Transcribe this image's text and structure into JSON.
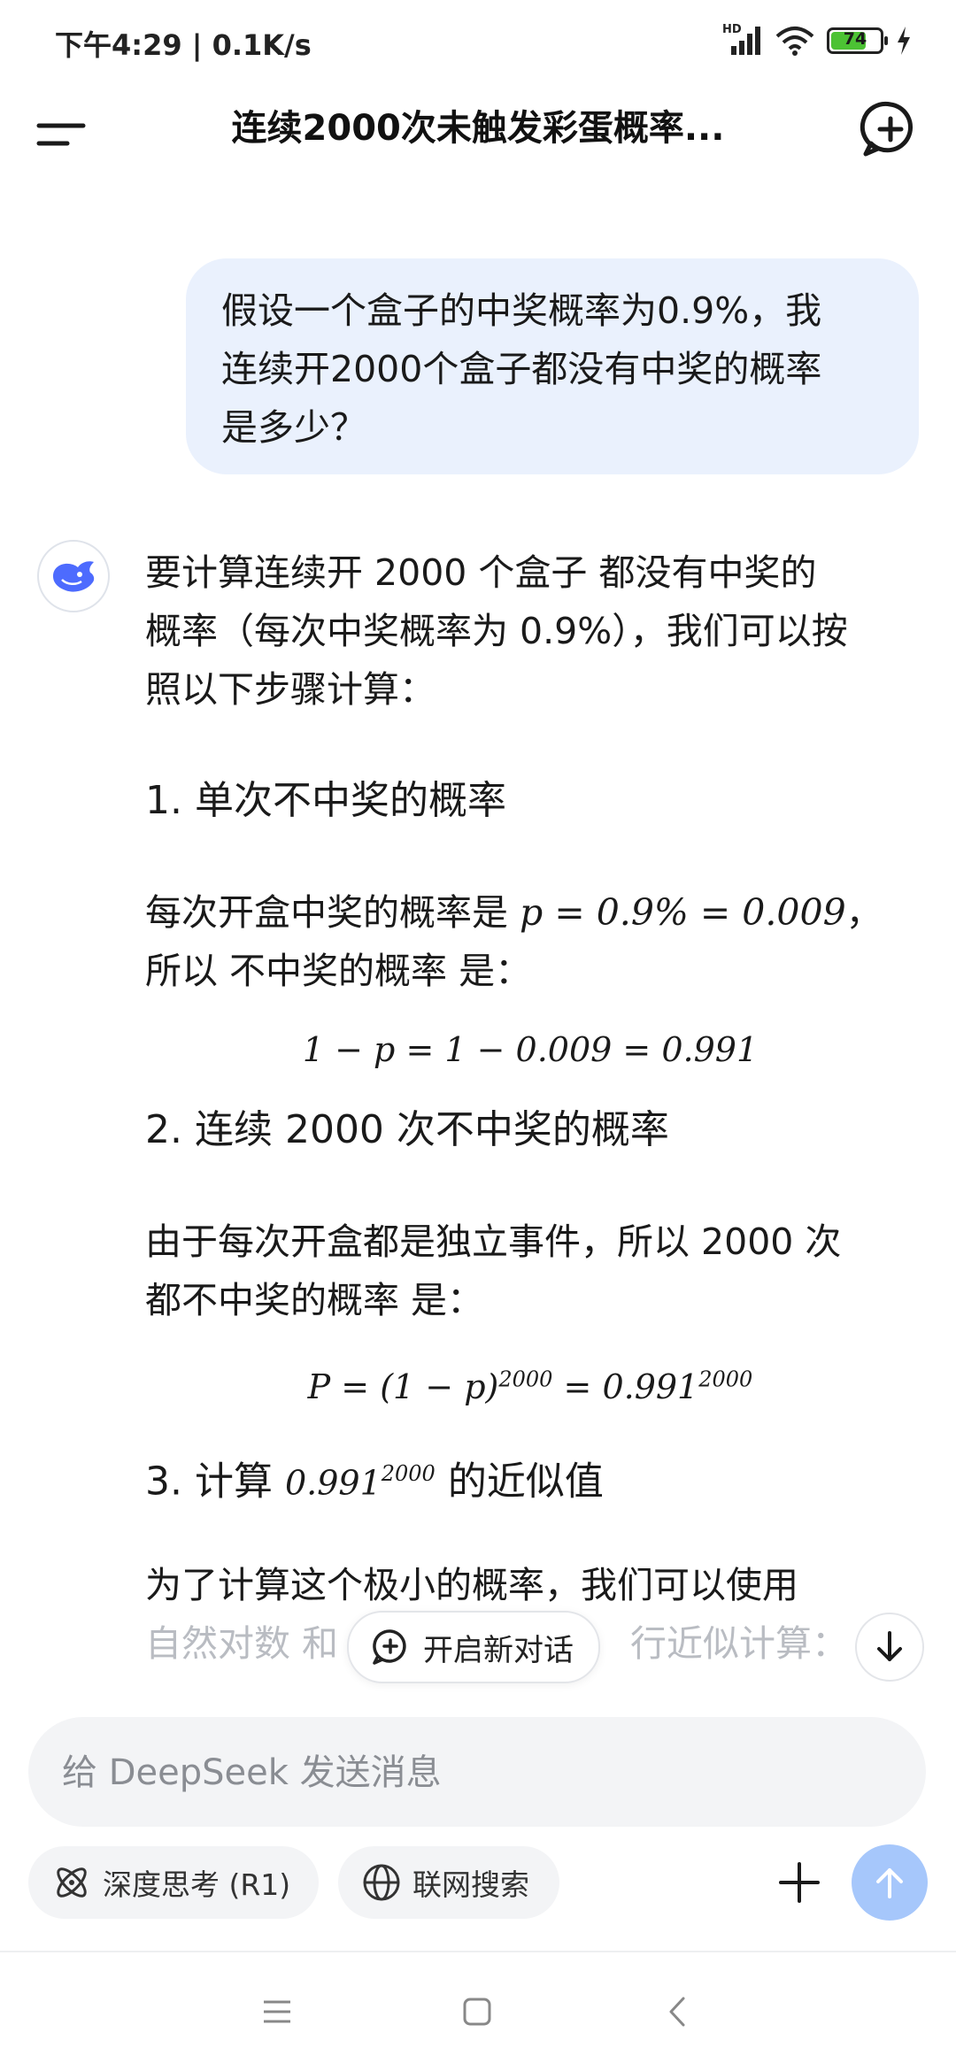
{
  "status_bar": {
    "time_speed": "下午4:29 | 0.1K/s",
    "network_label": "HD",
    "battery_level": 74,
    "battery_text": "74",
    "battery_color": "#4cc234"
  },
  "header": {
    "title": "连续2000次未触发彩蛋概率..."
  },
  "user_message": {
    "lines": [
      "假设一个盒子的中奖概率为0.9%，我",
      "连续开2000个盒子都没有中奖的概率",
      "是多少？"
    ]
  },
  "answer": {
    "intro_lines": [
      "要计算连续开 2000 个盒子 都没有中奖的",
      "概率（每次中奖概率为 0.9%），我们可以按",
      "照以下步骤计算："
    ],
    "section1_title": "1. 单次不中奖的概率",
    "section1_text_a": "每次开盒中奖的概率是 ",
    "section1_math": "p = 0.9% = 0.009",
    "section1_text_b": "，",
    "section1_line2": "所以 不中奖的概率 是：",
    "equation1": "1 − p = 1 − 0.009 = 0.991",
    "section2_title": "2. 连续 2000 次不中奖的概率",
    "section2_lines": [
      "由于每次开盒都是独立事件，所以 2000 次",
      "都不中奖的概率 是："
    ],
    "equation2_left": "P = (1 − p)",
    "equation2_exp1": "2000",
    "equation2_mid": " = 0.991",
    "equation2_exp2": "2000",
    "section3_prefix": "3. 计算 ",
    "section3_math": "0.991",
    "section3_exp": "2000",
    "section3_suffix": " 的近似值",
    "section3_line1": "为了计算这个极小的概率，我们可以使用",
    "section3_line2_left": "自然对数 和",
    "section3_line2_right": "行近似计算："
  },
  "floating": {
    "new_dialog_label": "开启新对话"
  },
  "composer": {
    "placeholder": "给 DeepSeek 发送消息",
    "value": ""
  },
  "toolbar": {
    "deep_think_label": "深度思考 (R1)",
    "web_search_label": "联网搜索"
  },
  "colors": {
    "accent": "#4d6bfe",
    "bubble_bg": "#eaf1fd",
    "send_button": "#a6c7fb"
  }
}
